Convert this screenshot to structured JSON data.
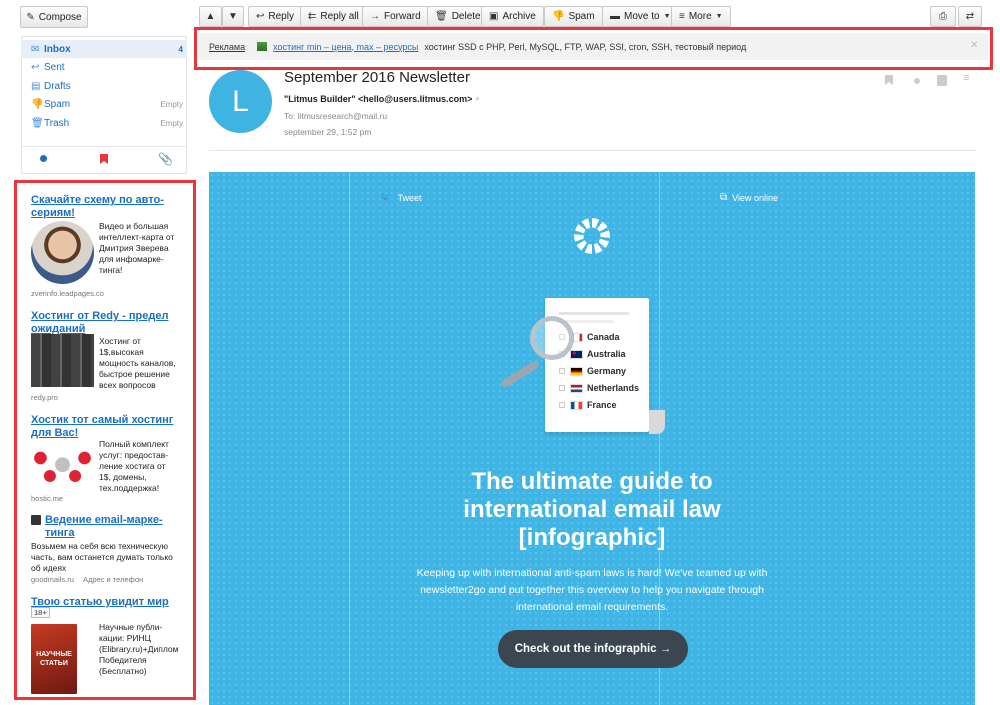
{
  "toolbar": {
    "compose": "Compose",
    "reply": "Reply",
    "reply_all": "Reply all",
    "forward": "Forward",
    "delete": "Delete",
    "archive": "Archive",
    "spam": "Spam",
    "move_to": "Move to",
    "more": "More"
  },
  "folders": [
    {
      "label": "Inbox",
      "count": "4"
    },
    {
      "label": "Sent",
      "count": ""
    },
    {
      "label": "Drafts",
      "count": ""
    },
    {
      "label": "Spam",
      "count": "Empty"
    },
    {
      "label": "Trash",
      "count": "Empty"
    }
  ],
  "top_ad": {
    "label": "Реклама",
    "link": "хостинг min – цена, max – ресурсы",
    "text": "хостинг SSD с PHP, Perl, MySQL, FTP, WAP, SSI, cron, SSH, тестовый период"
  },
  "ads": [
    {
      "title": "Скачайте схему по авто-сериям!",
      "text": "Видео и большая интеллект-карта от Дмитрия Зверева для инфомарке-тинга!",
      "source": "zverinfo.leadpages.co"
    },
    {
      "title": "Хостинг от Redy - предел ожиданий",
      "text": "Хостинг от 1$,высокая мощность каналов, быстрое решение всех вопросов",
      "source": "redy.pro"
    },
    {
      "title": "Хостик тот самый хостинг для Вас!",
      "text": "Полный комплект услуг: предостав-ление хостига от 1$, домены, тех.поддержка!",
      "source": "hostic.me"
    },
    {
      "title": "Ведение email-марке-тинга",
      "text": "Возьмем на себя всю техническую часть, вам останется думать только об идеях",
      "source": "goodmails.ru",
      "source_extra": "Адрес и телефон"
    },
    {
      "title": "Твою статью увидит мир",
      "age": "18+",
      "text": "Научные публи-кации: РИНЦ (Elibrary.ru)+Диплом Победителя (Бесплатно)",
      "book": "НАУЧНЫЕ СТАТЬИ"
    }
  ],
  "email": {
    "avatar_letter": "L",
    "subject": "September 2016 Newsletter",
    "from": "\"Litmus Builder\" <hello@users.litmus.com>",
    "to": "To: litmusresearch@mail.ru",
    "date": "september 29, 1:52 pm"
  },
  "hero": {
    "tweet": "Tweet",
    "view_online": "View online",
    "countries": [
      "Canada",
      "Australia",
      "Germany",
      "Netherlands",
      "France"
    ],
    "headline_1": "The ultimate guide to",
    "headline_2": "international email law",
    "headline_3": "[infographic]",
    "body": "Keeping up with international anti-spam laws is hard! We've teamed up with newsletter2go and put together this overview to help you navigate through international email requirements.",
    "cta": "Check out the infographic →"
  },
  "colors": {
    "accent_blue": "#1a6fc4",
    "hero_bg": "#3eb5e5",
    "avatar_bg": "#3fb4e3",
    "annotation_red": "#e8363a",
    "cta_bg": "#3b4650"
  }
}
